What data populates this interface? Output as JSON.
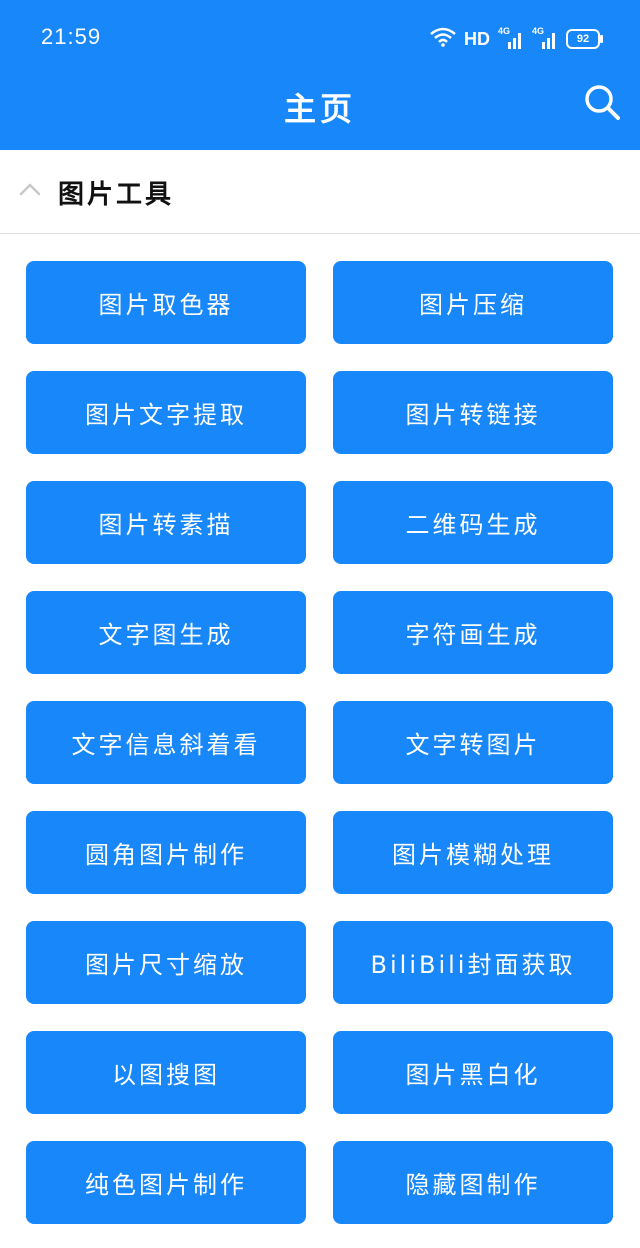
{
  "status_bar": {
    "time": "21:59",
    "hd_label": "HD",
    "network_1": "4G",
    "network_2": "4G",
    "battery": "92"
  },
  "header": {
    "title": "主页",
    "search_icon": "search-icon"
  },
  "section": {
    "title": "图片工具",
    "toggle_icon": "chevron-up-icon"
  },
  "tools": [
    {
      "label": "图片取色器"
    },
    {
      "label": "图片压缩"
    },
    {
      "label": "图片文字提取"
    },
    {
      "label": "图片转链接"
    },
    {
      "label": "图片转素描"
    },
    {
      "label": "二维码生成"
    },
    {
      "label": "文字图生成"
    },
    {
      "label": "字符画生成"
    },
    {
      "label": "文字信息斜着看"
    },
    {
      "label": "文字转图片"
    },
    {
      "label": "圆角图片制作"
    },
    {
      "label": "图片模糊处理"
    },
    {
      "label": "图片尺寸缩放"
    },
    {
      "label": "BiliBili封面获取"
    },
    {
      "label": "以图搜图"
    },
    {
      "label": "图片黑白化"
    },
    {
      "label": "纯色图片制作"
    },
    {
      "label": "隐藏图制作"
    }
  ],
  "colors": {
    "primary": "#1787fa",
    "background": "#ffffff",
    "divider": "#dcdcdc"
  }
}
